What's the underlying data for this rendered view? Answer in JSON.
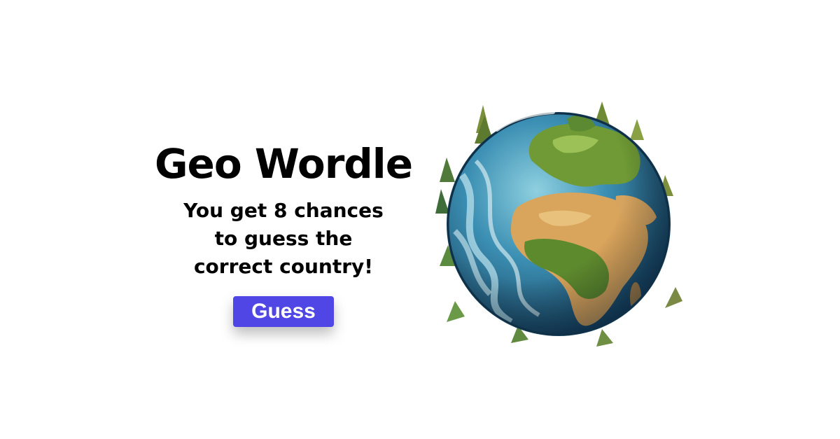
{
  "hero": {
    "title": "Geo Wordle",
    "tagline_lines": [
      "You get 8 chances",
      "to guess the",
      "correct country!"
    ],
    "guess_button_label": "Guess"
  },
  "colors": {
    "button": "#4f46e5",
    "button_text": "#ffffff",
    "text": "#000000",
    "background": "#ffffff",
    "ocean": "#2f7fa3",
    "land_green": "#6f9a35",
    "land_sand": "#d9a45c"
  },
  "globe": {
    "icon": "earth-globe-illustration"
  }
}
